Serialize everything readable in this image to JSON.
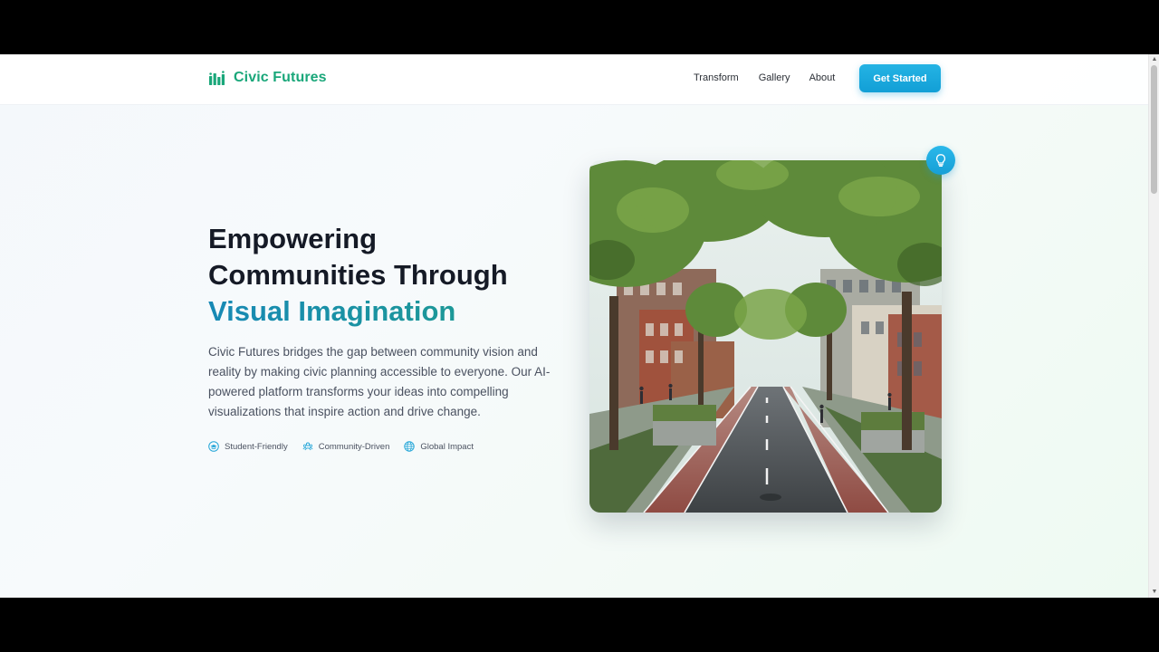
{
  "brand": {
    "name": "Civic Futures",
    "logo_icon": "bar-chart-icon",
    "color": "#1aa77a"
  },
  "nav": {
    "links": [
      {
        "label": "Transform"
      },
      {
        "label": "Gallery"
      },
      {
        "label": "About"
      }
    ],
    "cta_label": "Get Started"
  },
  "hero": {
    "title_line1": "Empowering",
    "title_line2": "Communities Through",
    "title_accent": "Visual Imagination",
    "description": "Civic Futures bridges the gap between community vision and reality by making civic planning accessible to everyone. Our AI-powered platform transforms your ideas into compelling visualizations that inspire action and drive change.",
    "features": [
      {
        "label": "Student-Friendly",
        "icon": "graduation-cap-icon"
      },
      {
        "label": "Community-Driven",
        "icon": "community-icon"
      },
      {
        "label": "Global Impact",
        "icon": "globe-icon"
      }
    ],
    "image_icon": "lightbulb-icon"
  },
  "colors": {
    "accent": "#129fd6",
    "brand_green": "#1aa77a",
    "heading": "#151a26"
  }
}
